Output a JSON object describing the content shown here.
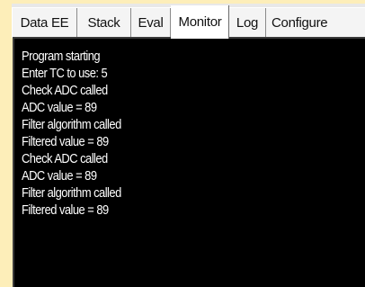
{
  "tabs": [
    {
      "label": "Data EE",
      "active": false
    },
    {
      "label": "Stack",
      "active": false
    },
    {
      "label": "Eval",
      "active": false
    },
    {
      "label": "Monitor",
      "active": true
    },
    {
      "label": "Log",
      "active": false
    },
    {
      "label": "Configure",
      "active": false
    }
  ],
  "console": {
    "lines": [
      "Program starting",
      "Enter TC to use: 5",
      "Check ADC called",
      "ADC value = 89",
      "Filter algorithm called",
      "Filtered value = 89",
      "Check ADC called",
      "ADC value = 89",
      "Filter algorithm called",
      "Filtered value = 89"
    ]
  },
  "colors": {
    "background": "#fdeeb9",
    "tabstrip": "#f4f4f4",
    "active_tab": "#ffffff",
    "console_bg": "#000000",
    "console_text": "#ffffff"
  }
}
